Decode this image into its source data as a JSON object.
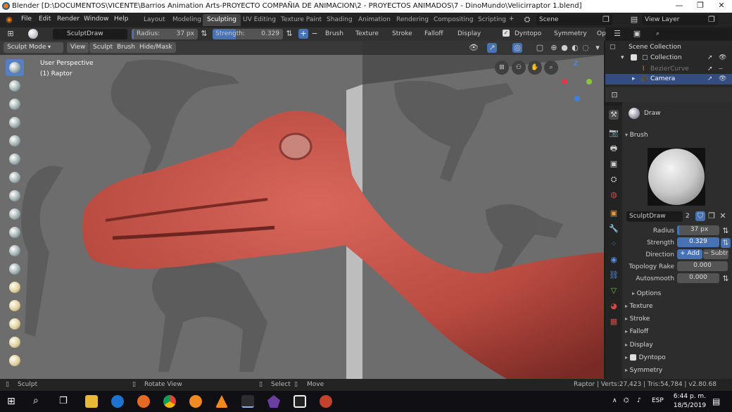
{
  "window": {
    "title": "Blender [D:\\DOCUMENTOS\\VICENTE\\Barrios Animation Arts-PROYECTO COMPAÑIA DE ANIMACION\\2 - PROYECTOS ANIMADOS\\7 - DinoMundo\\Velicirraptor 1.blend]",
    "minimize": "—",
    "restore": "❐",
    "close": "✕"
  },
  "menu": {
    "file": "File",
    "edit": "Edit",
    "render": "Render",
    "window": "Window",
    "help": "Help"
  },
  "workspaces": [
    "Layout",
    "Modeling",
    "Sculpting",
    "UV Editing",
    "Texture Paint",
    "Shading",
    "Animation",
    "Rendering",
    "Compositing",
    "Scripting"
  ],
  "active_workspace": "Sculpting",
  "scene": {
    "name": "Scene",
    "view_layer": "View Layer"
  },
  "tool_header": {
    "brush_name": "SculptDraw",
    "radius_label": "Radius:",
    "radius_value": "37 px",
    "strength_label": "Strength:",
    "strength_value": "0.329",
    "brush": "Brush",
    "texture": "Texture",
    "stroke": "Stroke",
    "falloff": "Falloff",
    "display": "Display",
    "dyntopo": "Dyntopo",
    "symmetry": "Symmetry",
    "options_short": "Op"
  },
  "viewport_header": {
    "mode": "Sculpt Mode",
    "view": "View",
    "sculpt": "Sculpt",
    "brush": "Brush",
    "hide_mask": "Hide/Mask"
  },
  "viewport": {
    "perspective": "User Perspective",
    "object": "(1) Raptor",
    "axis_z": "Z"
  },
  "outliner": {
    "scene_collection": "Scene Collection",
    "collection": "Collection",
    "items": [
      "BezierCurve",
      "Camera"
    ]
  },
  "properties": {
    "tool_name": "Draw",
    "brush_section": "Brush",
    "brush_datablock": "SculptDraw",
    "users": "2",
    "radius_label": "Radius",
    "radius_value": "37 px",
    "strength_label": "Strength",
    "strength_value": "0.329",
    "direction_label": "Direction",
    "add": "Add",
    "subtract": "Subtr",
    "topology_label": "Topology Rake",
    "topology_value": "0.000",
    "autosmooth_label": "Autosmooth",
    "autosmooth_value": "0.000",
    "options": "Options",
    "sections": [
      "Texture",
      "Stroke",
      "Falloff",
      "Display",
      "Dyntopo",
      "Symmetry"
    ]
  },
  "status": {
    "sculpt": "Sculpt",
    "rotate": "Rotate View",
    "select": "Select",
    "move": "Move",
    "stats": "Raptor | Verts:27,423 | Tris:54,784 | v2.80.68"
  },
  "taskbar": {
    "time": "6:44 p. m.",
    "date": "18/5/2019",
    "lang": "ESP"
  },
  "colors": {
    "accent": "#4772b3",
    "model": "#b84a40",
    "viewport_bg": "#6d6d6d"
  }
}
